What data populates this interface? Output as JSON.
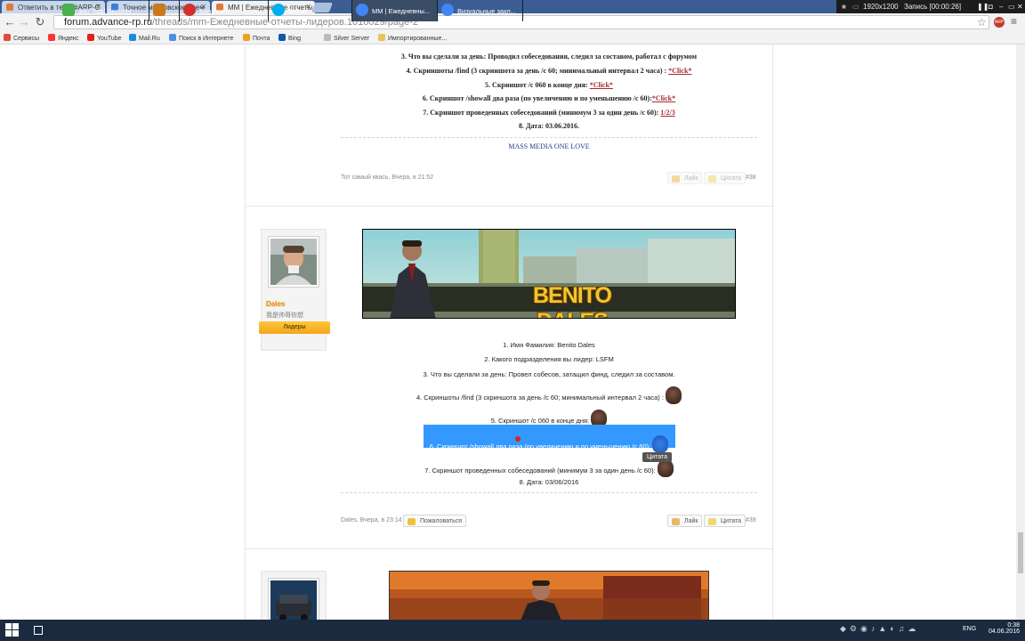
{
  "browser": {
    "tabs": [
      {
        "label": "Ответить в теме #ARP-C"
      },
      {
        "label": "Точное московское врем"
      },
      {
        "label": "MM | Ежедневные отчеты"
      }
    ],
    "url_host": "forum.advance-rp.ru",
    "url_path": "/threads/mm-Ежедневные-отчеты-лидеров.1010029/page-2",
    "recorder": {
      "resolution": "1920x1200",
      "status": "Запись [00:00:26]"
    },
    "ext_badge": "ARP",
    "bookmarks": [
      {
        "label": "Сервисы",
        "icon": "apps-grid-icon",
        "color": "#e04b3a"
      },
      {
        "label": "Яндекс",
        "icon": "yandex-icon",
        "color": "#ff3333"
      },
      {
        "label": "YouTube",
        "icon": "youtube-icon",
        "color": "#e62117"
      },
      {
        "label": "Mail.Ru",
        "icon": "mailru-icon",
        "color": "#168de2"
      },
      {
        "label": "Поиск в Интернете",
        "icon": "search-icon",
        "color": "#4a90e2"
      },
      {
        "label": "Почта",
        "icon": "mail-icon",
        "color": "#f0a020"
      },
      {
        "label": "Bing",
        "icon": "bing-icon",
        "color": "#0a5ca8"
      },
      {
        "label": "Silver Server",
        "icon": "page-icon",
        "color": "#bbbbbb"
      },
      {
        "label": "Импортированные...",
        "icon": "folder-icon",
        "color": "#e8c25a"
      }
    ]
  },
  "post38": {
    "line3": "3. Что вы сделали за день: Проводил собеседования, следил за составом, работал с форумом",
    "line4": "4. Скриншоты /find (3 скриншота за день /c 60; минимальный интервал 2 часа) :",
    "line4_link": "*Click*",
    "line5": "5. Скриншот /c 060 в конце дня:",
    "line5_link": "*Click*",
    "line6": "6. Скриншот /showall два раза (по увеличению и по уменьшению /c 60):",
    "line6_link": "*Click*",
    "line7": "7. Скриншот проведенных собеседований (минимум 3 за один день /c 60):",
    "line7_link": "1/2/3",
    "line8": "8. Дата: 03.06.2016.",
    "signature": "MASS MEDIA ONE LOVE",
    "author_meta": "Тот самый квась, Вчера, в 21:52",
    "like": "Лайк",
    "quote": "Цитата",
    "number": "#38"
  },
  "post39": {
    "username": "Dales",
    "user_title": "我是帅哥你想",
    "role": "Лидеры",
    "banner_text": "BENITO DALES",
    "line1": "1. Имя Фамилия: Benito Dales",
    "line2": "2. Какого подразделения вы лидер: LSFM",
    "line3": "3. Что вы сделали за день: Провел собесов, затащил финд, следил за составом.",
    "line4": "4. Скриншоты /find (3 скриншота за день /c 60; минимальный интервал 2 часа) :",
    "line5": "5. Скриншот /c 060 в конце дня:",
    "line6": "6. Скриншот /showall два раза (по увеличению и по уменьшению /c 60):",
    "line7": "7. Скриншот проведенных собеседований (минимум 3 за один день /c 60):",
    "line8": "8. Дата: 03/06/2016",
    "tooltip": "Цитата",
    "author_meta": "Dales, Вчера, в 23:14",
    "report": "Пожаловаться",
    "like": "Лайк",
    "quote": "Цитата",
    "number": "#39"
  },
  "taskbar": {
    "items": [
      {
        "label": "360 Total Security",
        "color": "#4caf50"
      },
      {
        "label": "",
        "color": "#c97a1a"
      },
      {
        "label": "Bandicam",
        "color": "#d32f2f"
      },
      {
        "label": "Skype",
        "color": "#00aff0"
      },
      {
        "label": "MM | Ежедневны...",
        "color": "#4285f4"
      },
      {
        "label": "Визуальные закл...",
        "color": "#4285f4"
      }
    ],
    "lang": "ENG",
    "time": "0:38",
    "date": "04.06.2016"
  }
}
